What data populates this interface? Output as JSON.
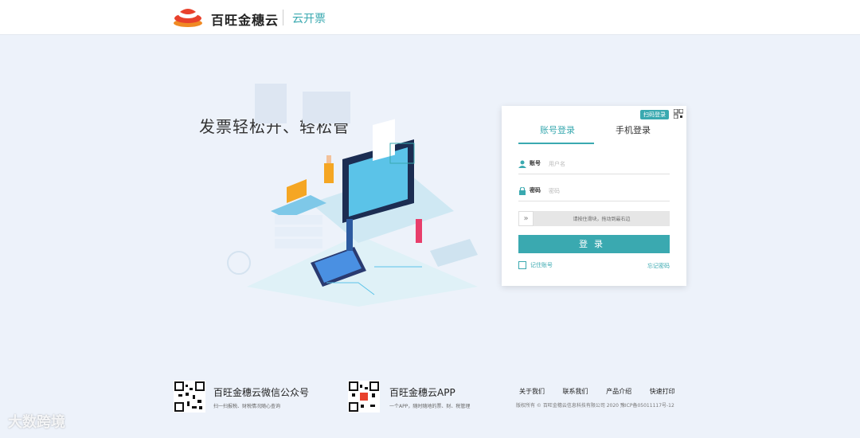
{
  "header": {
    "brand": "百旺金穗云",
    "product": "云开票"
  },
  "hero": {
    "slogan": "发票轻松开、轻松管"
  },
  "login": {
    "qr_tag": "扫码登录",
    "tabs": [
      {
        "label": "账号登录",
        "active": true
      },
      {
        "label": "手机登录",
        "active": false
      }
    ],
    "account_label": "账号",
    "account_placeholder": "用户名",
    "password_label": "密码",
    "password_placeholder": "密码",
    "slider_text": "请按住滑块，拖动到最右边",
    "slider_handle": "»",
    "submit_label": "登录",
    "remember_label": "记住账号",
    "forgot_label": "忘记密码"
  },
  "footer": {
    "wechat_title": "百旺金穗云微信公众号",
    "wechat_sub": "扫一扫报税、财税情况随心查询",
    "app_title": "百旺金穗云APP",
    "app_sub": "一个APP，随时随地的票、财、税管理",
    "links": [
      "关于我们",
      "联系我们",
      "产品介绍",
      "快速打印"
    ],
    "copyright": "版权所有 © 百旺金穗云信息科技有限公司 2020   豫ICP备05011117号-12"
  },
  "watermark": "大数跨境",
  "colors": {
    "accent": "#3aa9b0",
    "brand_red": "#e8412c",
    "background": "#edf2fa"
  }
}
